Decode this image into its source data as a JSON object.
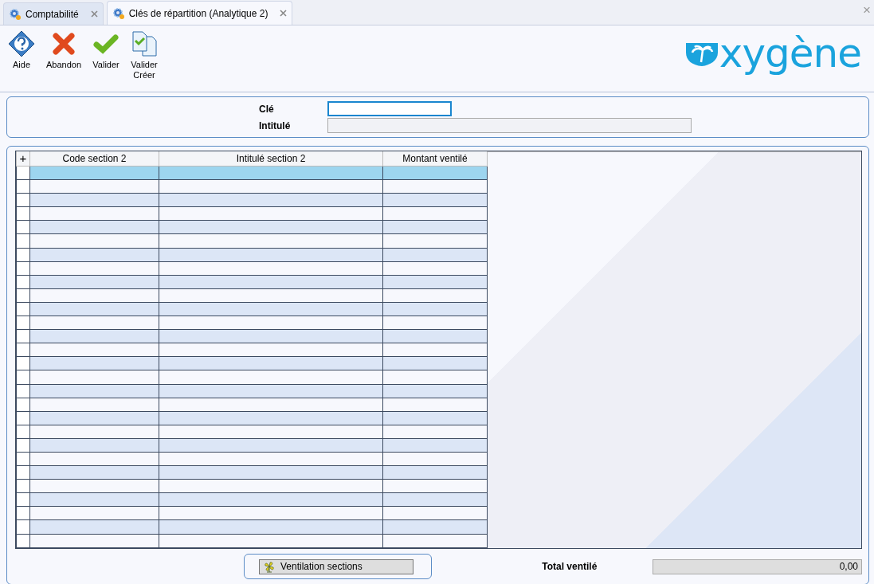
{
  "tabs": [
    {
      "label": "Comptabilité",
      "selected": false
    },
    {
      "label": "Clés de répartition (Analytique 2)",
      "selected": true
    }
  ],
  "window_close": "×",
  "toolbar": [
    {
      "kind": "help",
      "label": "Aide"
    },
    {
      "kind": "cancel",
      "label": "Abandon"
    },
    {
      "kind": "validate",
      "label": "Valider"
    },
    {
      "kind": "validate-create",
      "label": "Valider\nCréer"
    }
  ],
  "logo": "xygène",
  "form": {
    "fields": [
      {
        "label": "Clé",
        "focused": true
      },
      {
        "label": "Intitulé",
        "focused": false
      }
    ]
  },
  "table": {
    "add": "+",
    "columns": [
      "Code section 2",
      "Intitulé section 2",
      "Montant ventilé"
    ],
    "rows": [
      {
        "selected": true
      },
      {
        "selected": false
      },
      {
        "selected": false
      },
      {
        "selected": false
      },
      {
        "selected": false
      },
      {
        "selected": false
      },
      {
        "selected": false
      },
      {
        "selected": false
      },
      {
        "selected": false
      },
      {
        "selected": false
      },
      {
        "selected": false
      },
      {
        "selected": false
      },
      {
        "selected": false
      },
      {
        "selected": false
      },
      {
        "selected": false
      },
      {
        "selected": false
      },
      {
        "selected": false
      },
      {
        "selected": false
      },
      {
        "selected": false
      },
      {
        "selected": false
      },
      {
        "selected": false
      },
      {
        "selected": false
      },
      {
        "selected": false
      },
      {
        "selected": false
      },
      {
        "selected": false
      },
      {
        "selected": false
      },
      {
        "selected": false
      },
      {
        "selected": false
      }
    ]
  },
  "footer": {
    "button": "Ventilation sections",
    "total_label": "Total ventilé",
    "total_value": "0,00"
  }
}
